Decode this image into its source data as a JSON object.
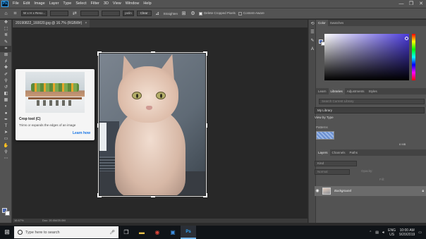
{
  "menubar": {
    "logo": "Ps",
    "items": [
      "File",
      "Edit",
      "Image",
      "Layer",
      "Type",
      "Select",
      "Filter",
      "3D",
      "View",
      "Window",
      "Help"
    ],
    "minimize": "—",
    "maximize": "❐",
    "close": "✕"
  },
  "optbar": {
    "ratio_select": "W x H x Reso...",
    "unit_select": "px/in",
    "clear_label": "Clear",
    "straighten_label": "Straighten",
    "delete_cropped_label": "Delete Cropped Pixels",
    "content_aware_label": "Content-Aware",
    "delete_cropped_checked": true,
    "content_aware_checked": false
  },
  "document": {
    "tab_title": "20190822_160020.jpg @ 16.7% (RGB/8#)",
    "tab_close": "×",
    "zoom": "16.67%",
    "doc_size": "Doc: 20.0M/20.0M"
  },
  "tooltip": {
    "title": "Crop tool (C)",
    "description": "Trims or expands the edges of an image",
    "learn_more": "Learn how"
  },
  "panels": {
    "color_tabs": [
      "Color",
      "Swatches"
    ],
    "library_tabs": [
      "Learn",
      "Libraries",
      "Adjustments",
      "Styles"
    ],
    "library_search": "Search Current Library",
    "library_name": "My Library",
    "view_by": "View by Type",
    "patterns_label": "Patterns",
    "library_size": "6 MB",
    "layer_tabs": [
      "Layers",
      "Channels",
      "Paths"
    ],
    "layer_kind": "Kind",
    "blend_mode": "Normal",
    "opacity_label": "Opacity:",
    "fill_label": "Fill:",
    "layer_name": "Background"
  },
  "taskbar": {
    "search_placeholder": "Type here to search",
    "lang": "ENG",
    "region": "US",
    "time": "10:00 AM",
    "date": "9/20/2019"
  },
  "colors": {
    "foreground": "#4a67b0",
    "background": "#ffffff",
    "accent_link": "#1473e6"
  }
}
